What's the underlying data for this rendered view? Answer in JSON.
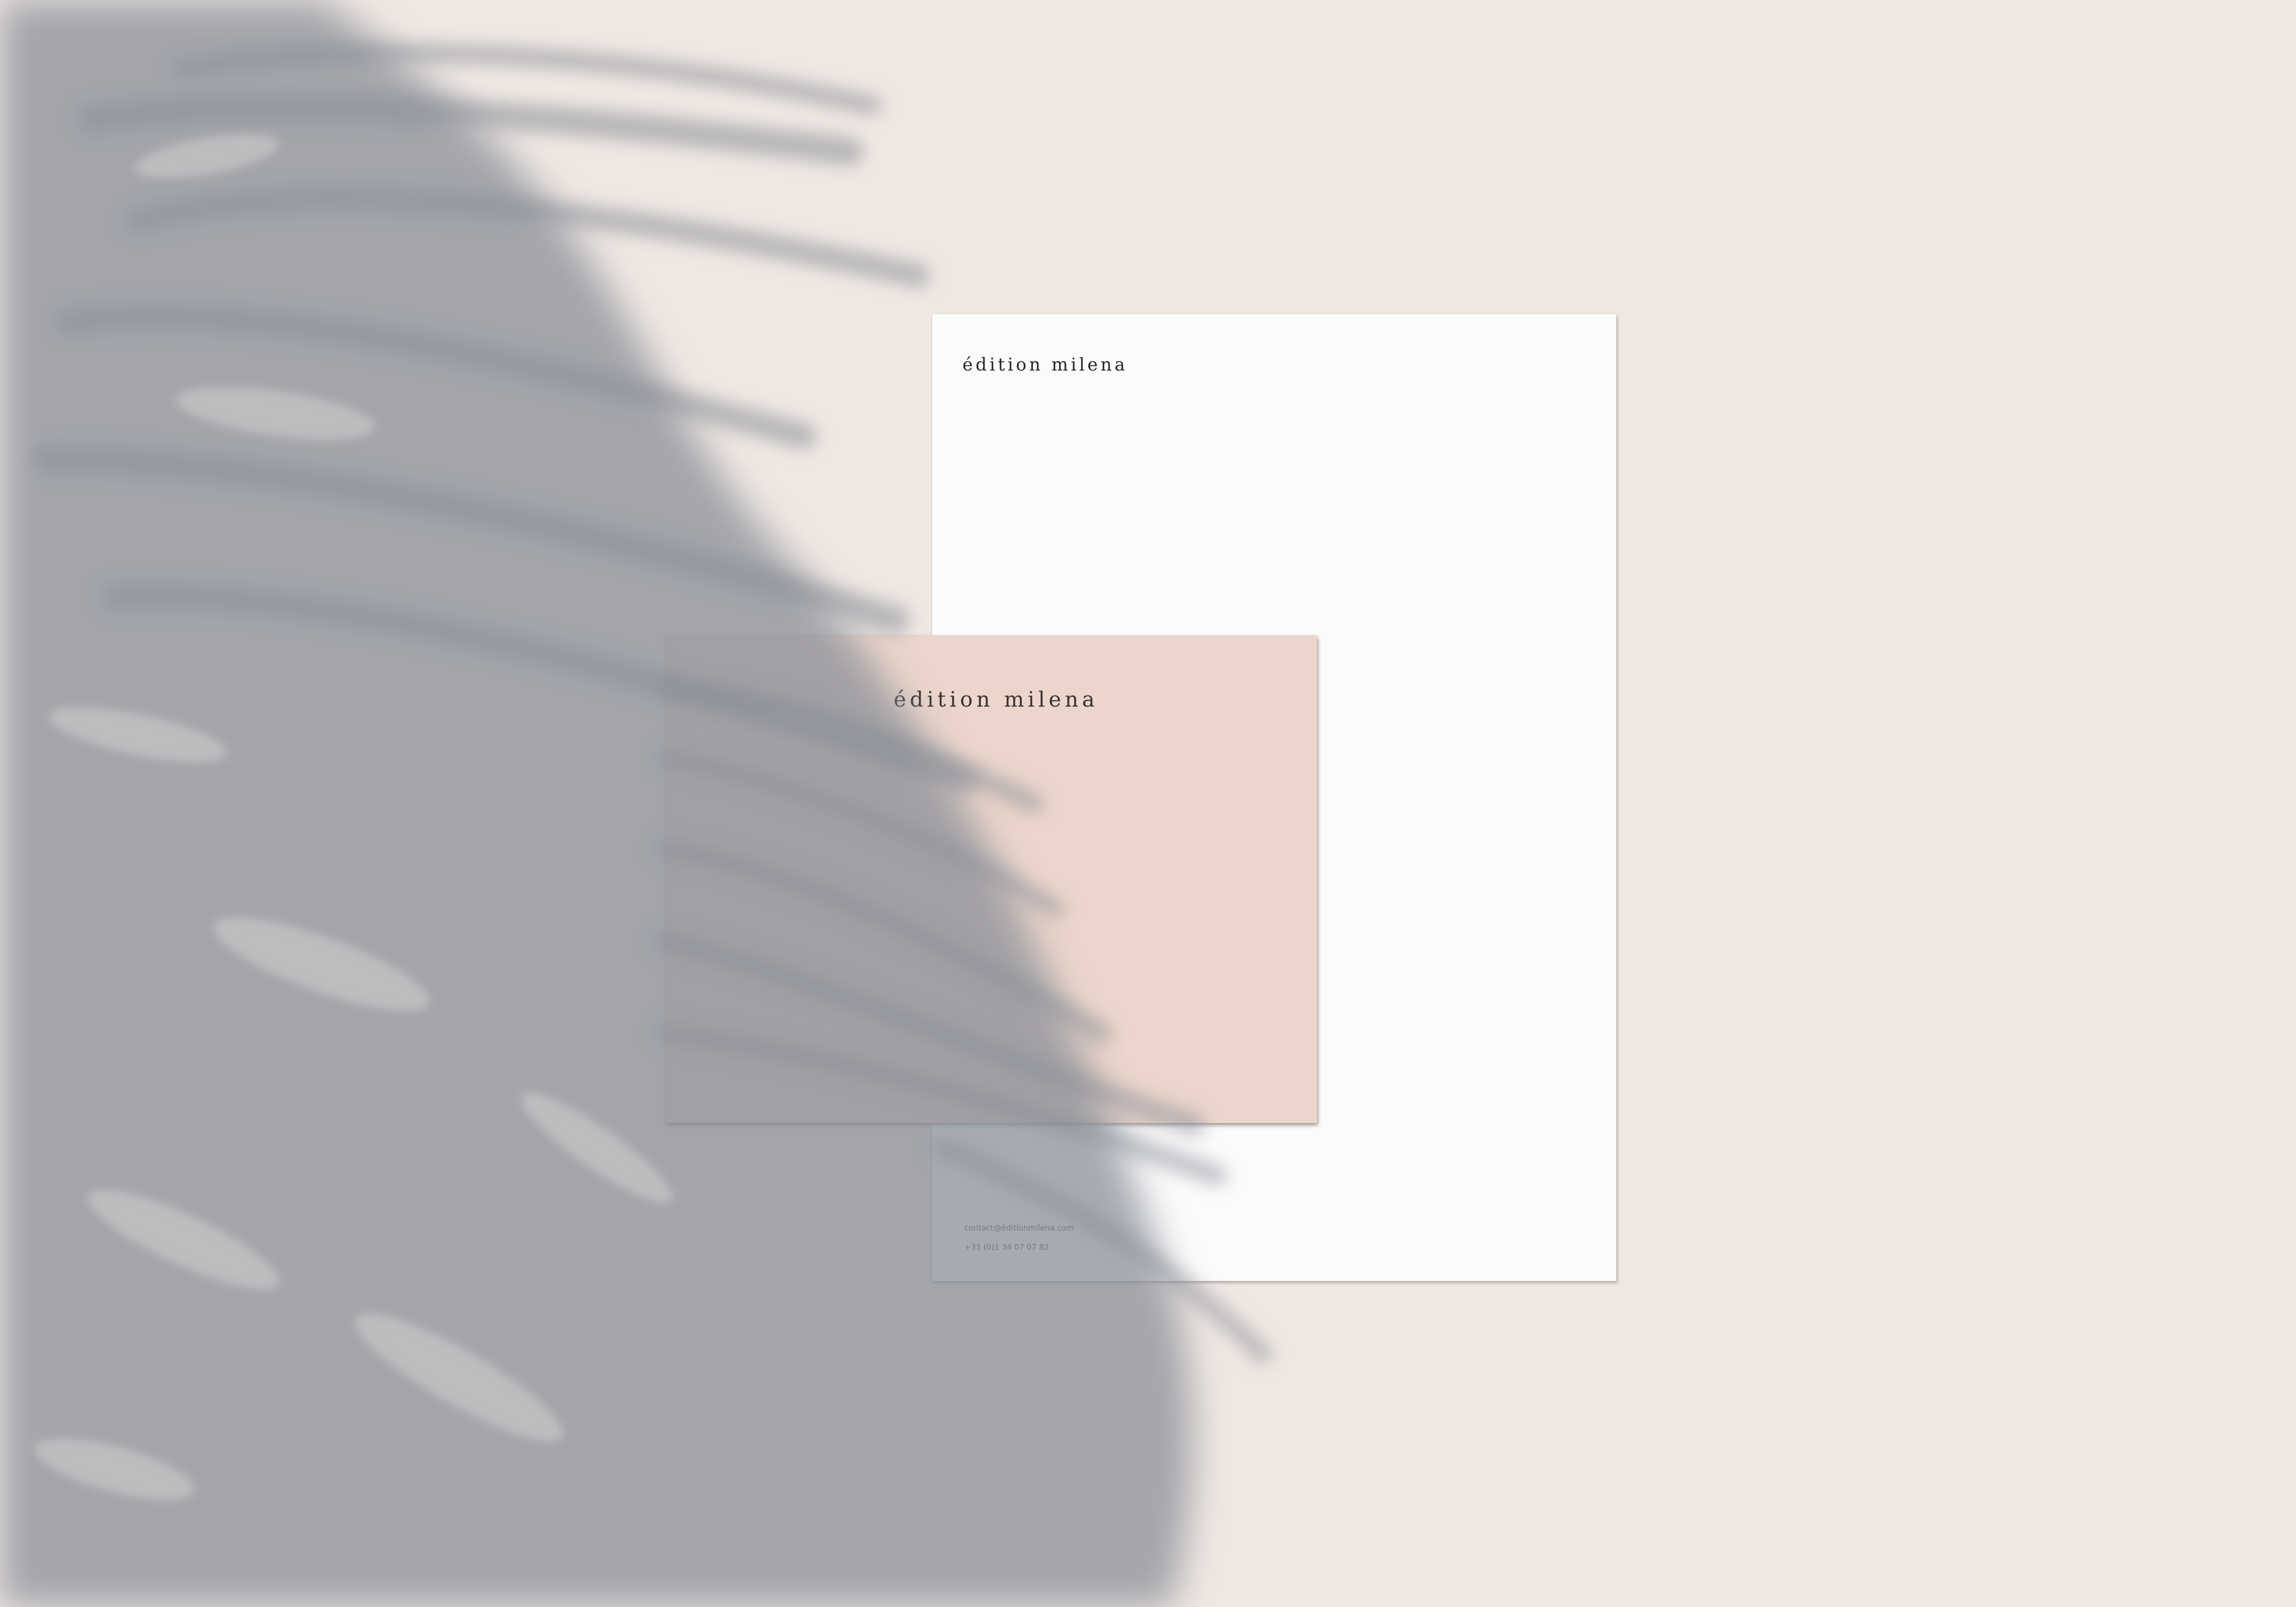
{
  "scene": {
    "background_color": "#efe7e2",
    "shadow_color": "#8f949d"
  },
  "letterhead": {
    "brand": "édition milena",
    "email": "contact@éditionmilena.com",
    "phone": "+33 (0)1 34 07 07 82",
    "paper_color": "#fbfbfb"
  },
  "card": {
    "brand": "édition milena",
    "card_color": "#ecd6cb"
  }
}
